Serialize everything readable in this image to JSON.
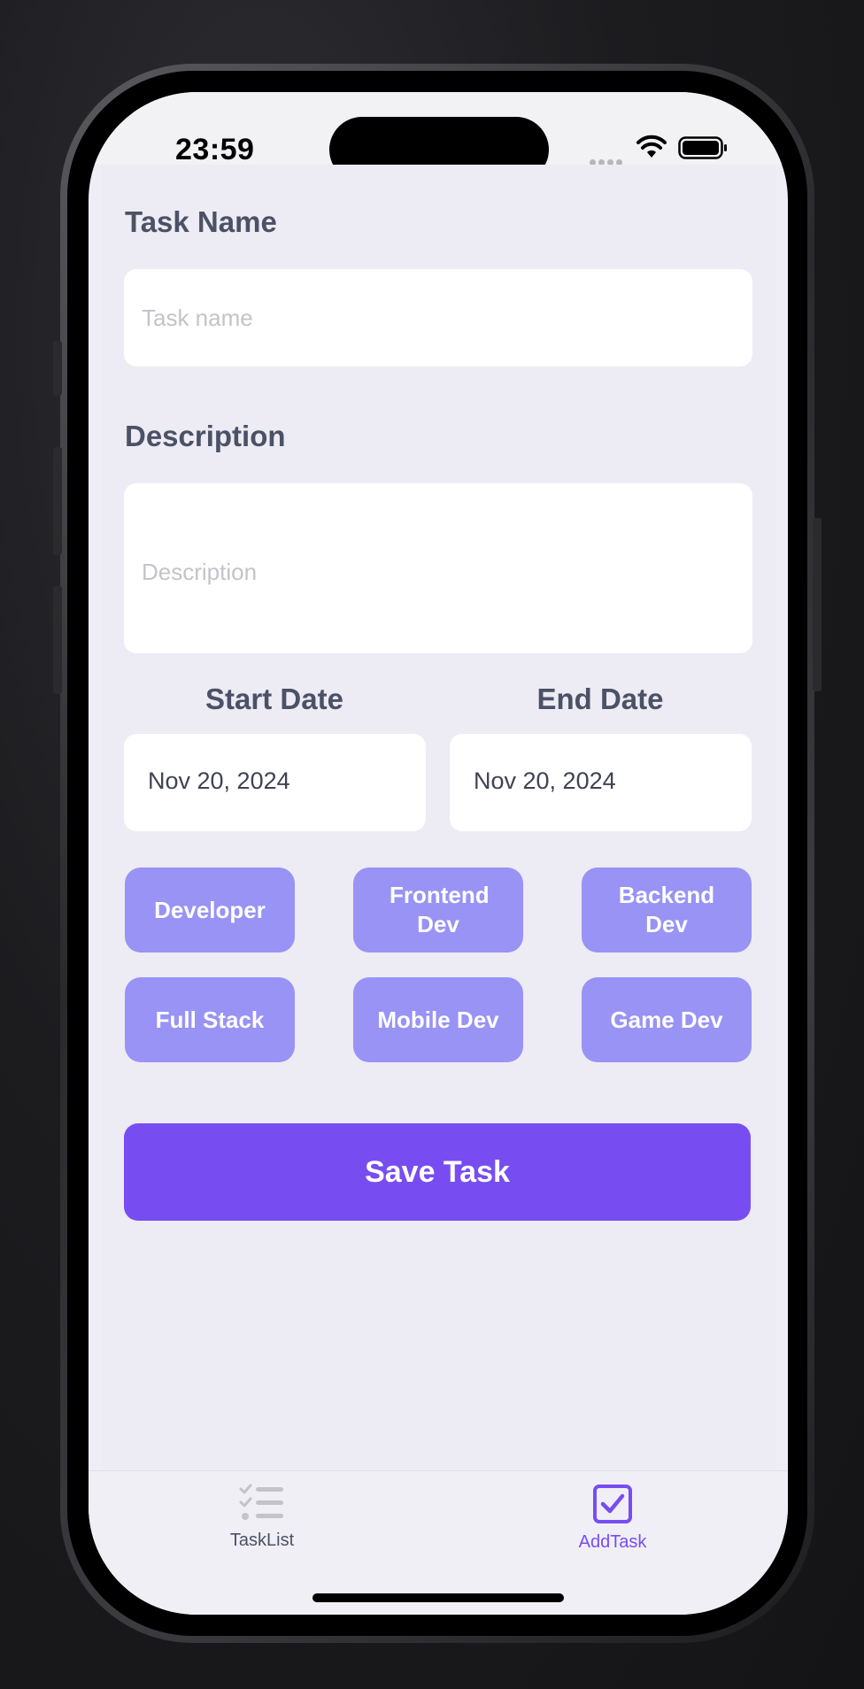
{
  "status_bar": {
    "time": "23:59"
  },
  "form": {
    "task_name_label": "Task Name",
    "task_name_placeholder": "Task name",
    "description_label": "Description",
    "description_placeholder": "Description",
    "start_date_label": "Start Date",
    "end_date_label": "End Date",
    "start_date_value": "Nov 20, 2024",
    "end_date_value": "Nov 20, 2024"
  },
  "categories": [
    "Developer",
    "Frontend Dev",
    "Backend Dev",
    "Full Stack",
    "Mobile Dev",
    "Game Dev"
  ],
  "save_button": {
    "label": "Save Task"
  },
  "tabbar": {
    "tabs": [
      {
        "label": "TaskList",
        "icon": "checklist-icon",
        "active": false
      },
      {
        "label": "AddTask",
        "icon": "checkbox-icon",
        "active": true
      }
    ]
  },
  "colors": {
    "accent": "#774df2",
    "chip": "#9893f5",
    "label": "#4b5166",
    "background": "#efedf5",
    "inactive_tab": "#8e8e93"
  }
}
